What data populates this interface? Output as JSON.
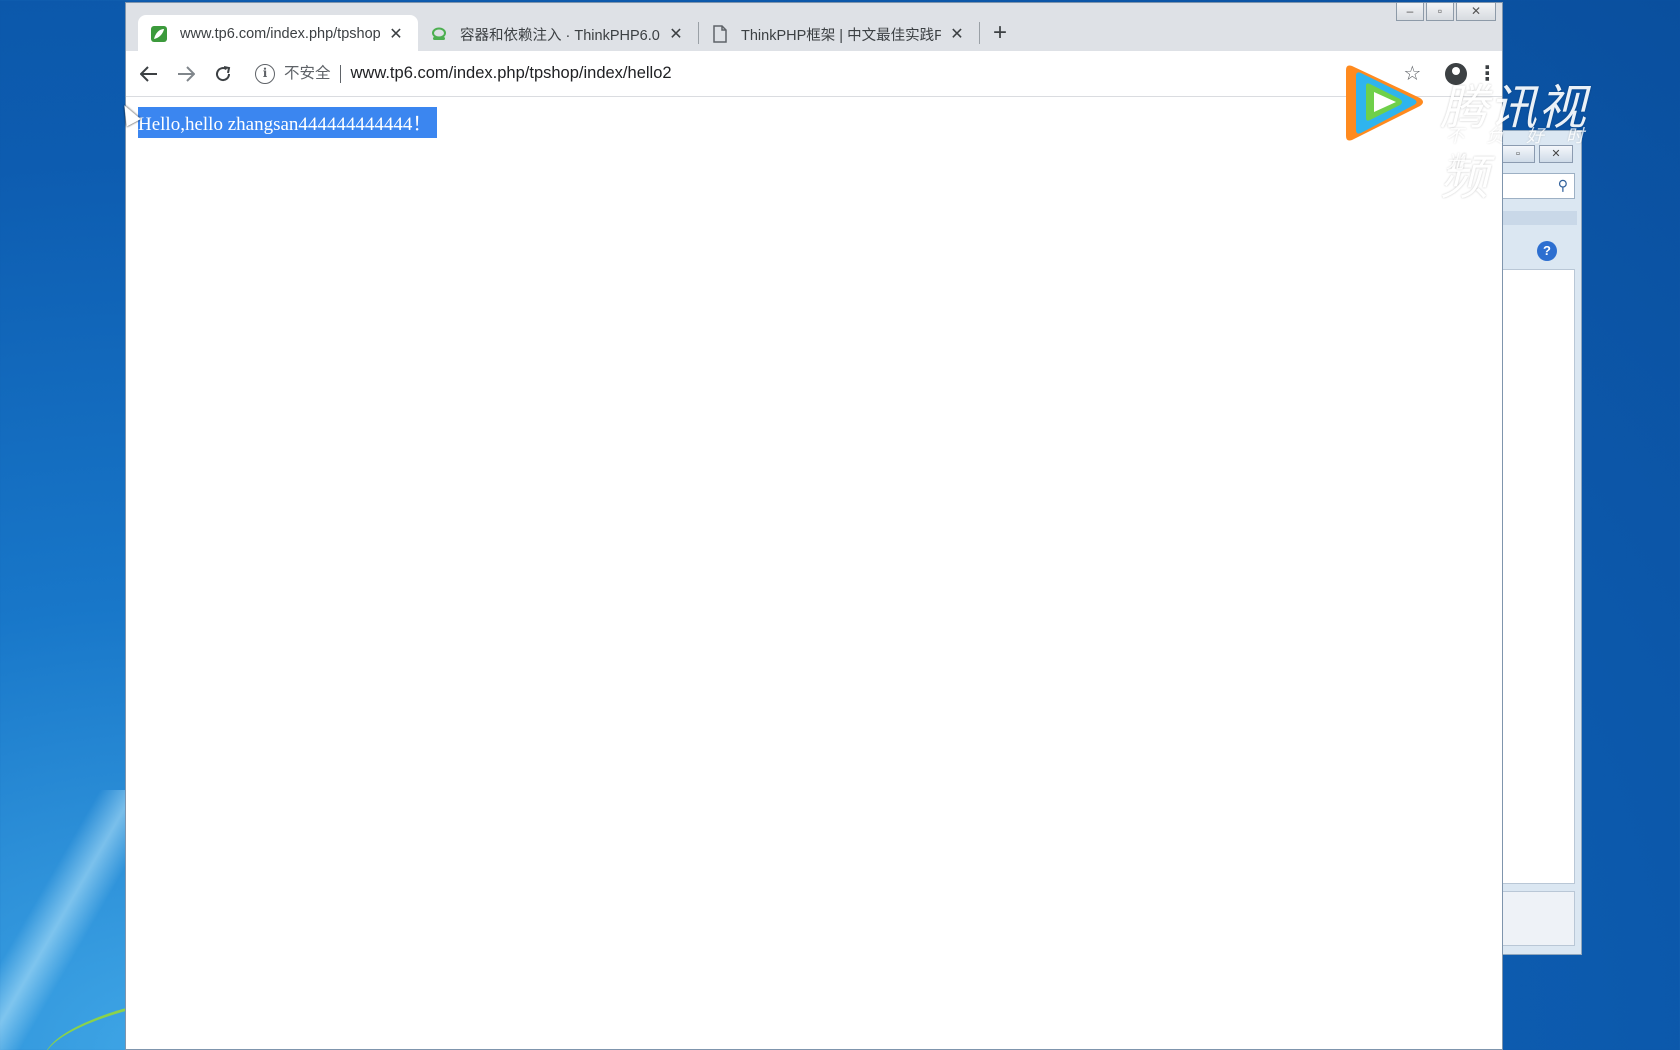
{
  "browser": {
    "tabs": [
      {
        "title": "www.tp6.com/index.php/tpshop",
        "favicon": "leaf-icon",
        "active": true
      },
      {
        "title": "容器和依赖注入 · ThinkPHP6.0",
        "favicon": "kanban-icon",
        "active": false
      },
      {
        "title": "ThinkPHP框架 | 中文最佳实践PH",
        "favicon": "page-icon",
        "active": false
      }
    ],
    "new_tab_label": "+",
    "close_glyph": "✕",
    "security_label": "不安全",
    "url": "www.tp6.com/index.php/tpshop/index/hello2"
  },
  "page": {
    "text": "Hello,hello zhangsan444444444444！"
  },
  "watermark": {
    "brand": "腾讯视频",
    "slogan": "不负好时光"
  },
  "colors": {
    "selection": "#3b86f0",
    "desktop": "#0d5cb0"
  }
}
